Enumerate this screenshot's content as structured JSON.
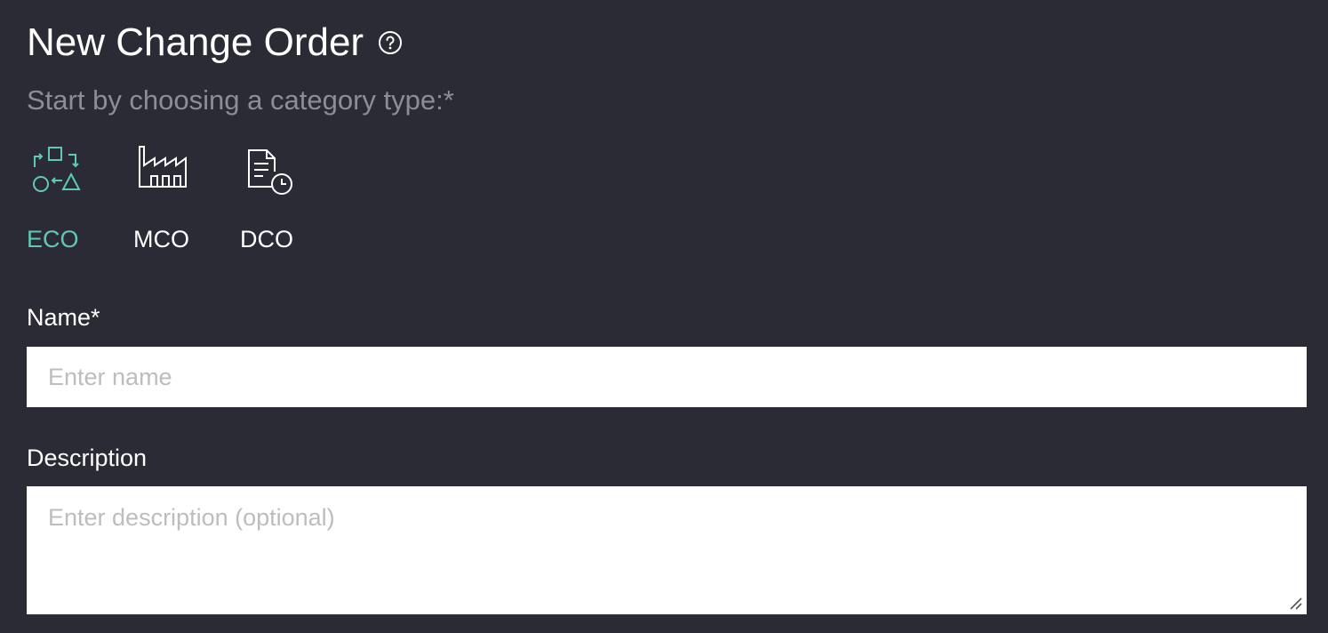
{
  "page": {
    "title": "New Change Order",
    "subtitle": "Start by choosing a category type:*"
  },
  "categories": [
    {
      "label": "ECO",
      "icon": "eco-process-icon",
      "selected": true
    },
    {
      "label": "MCO",
      "icon": "factory-icon",
      "selected": false
    },
    {
      "label": "DCO",
      "icon": "document-clock-icon",
      "selected": false
    }
  ],
  "form": {
    "name_label": "Name*",
    "name_placeholder": "Enter name",
    "name_value": "",
    "description_label": "Description",
    "description_placeholder": "Enter description (optional)",
    "description_value": ""
  },
  "colors": {
    "background": "#2b2b36",
    "accent": "#5fc9b4",
    "subtitle": "#8d8d95",
    "text": "#ffffff"
  }
}
